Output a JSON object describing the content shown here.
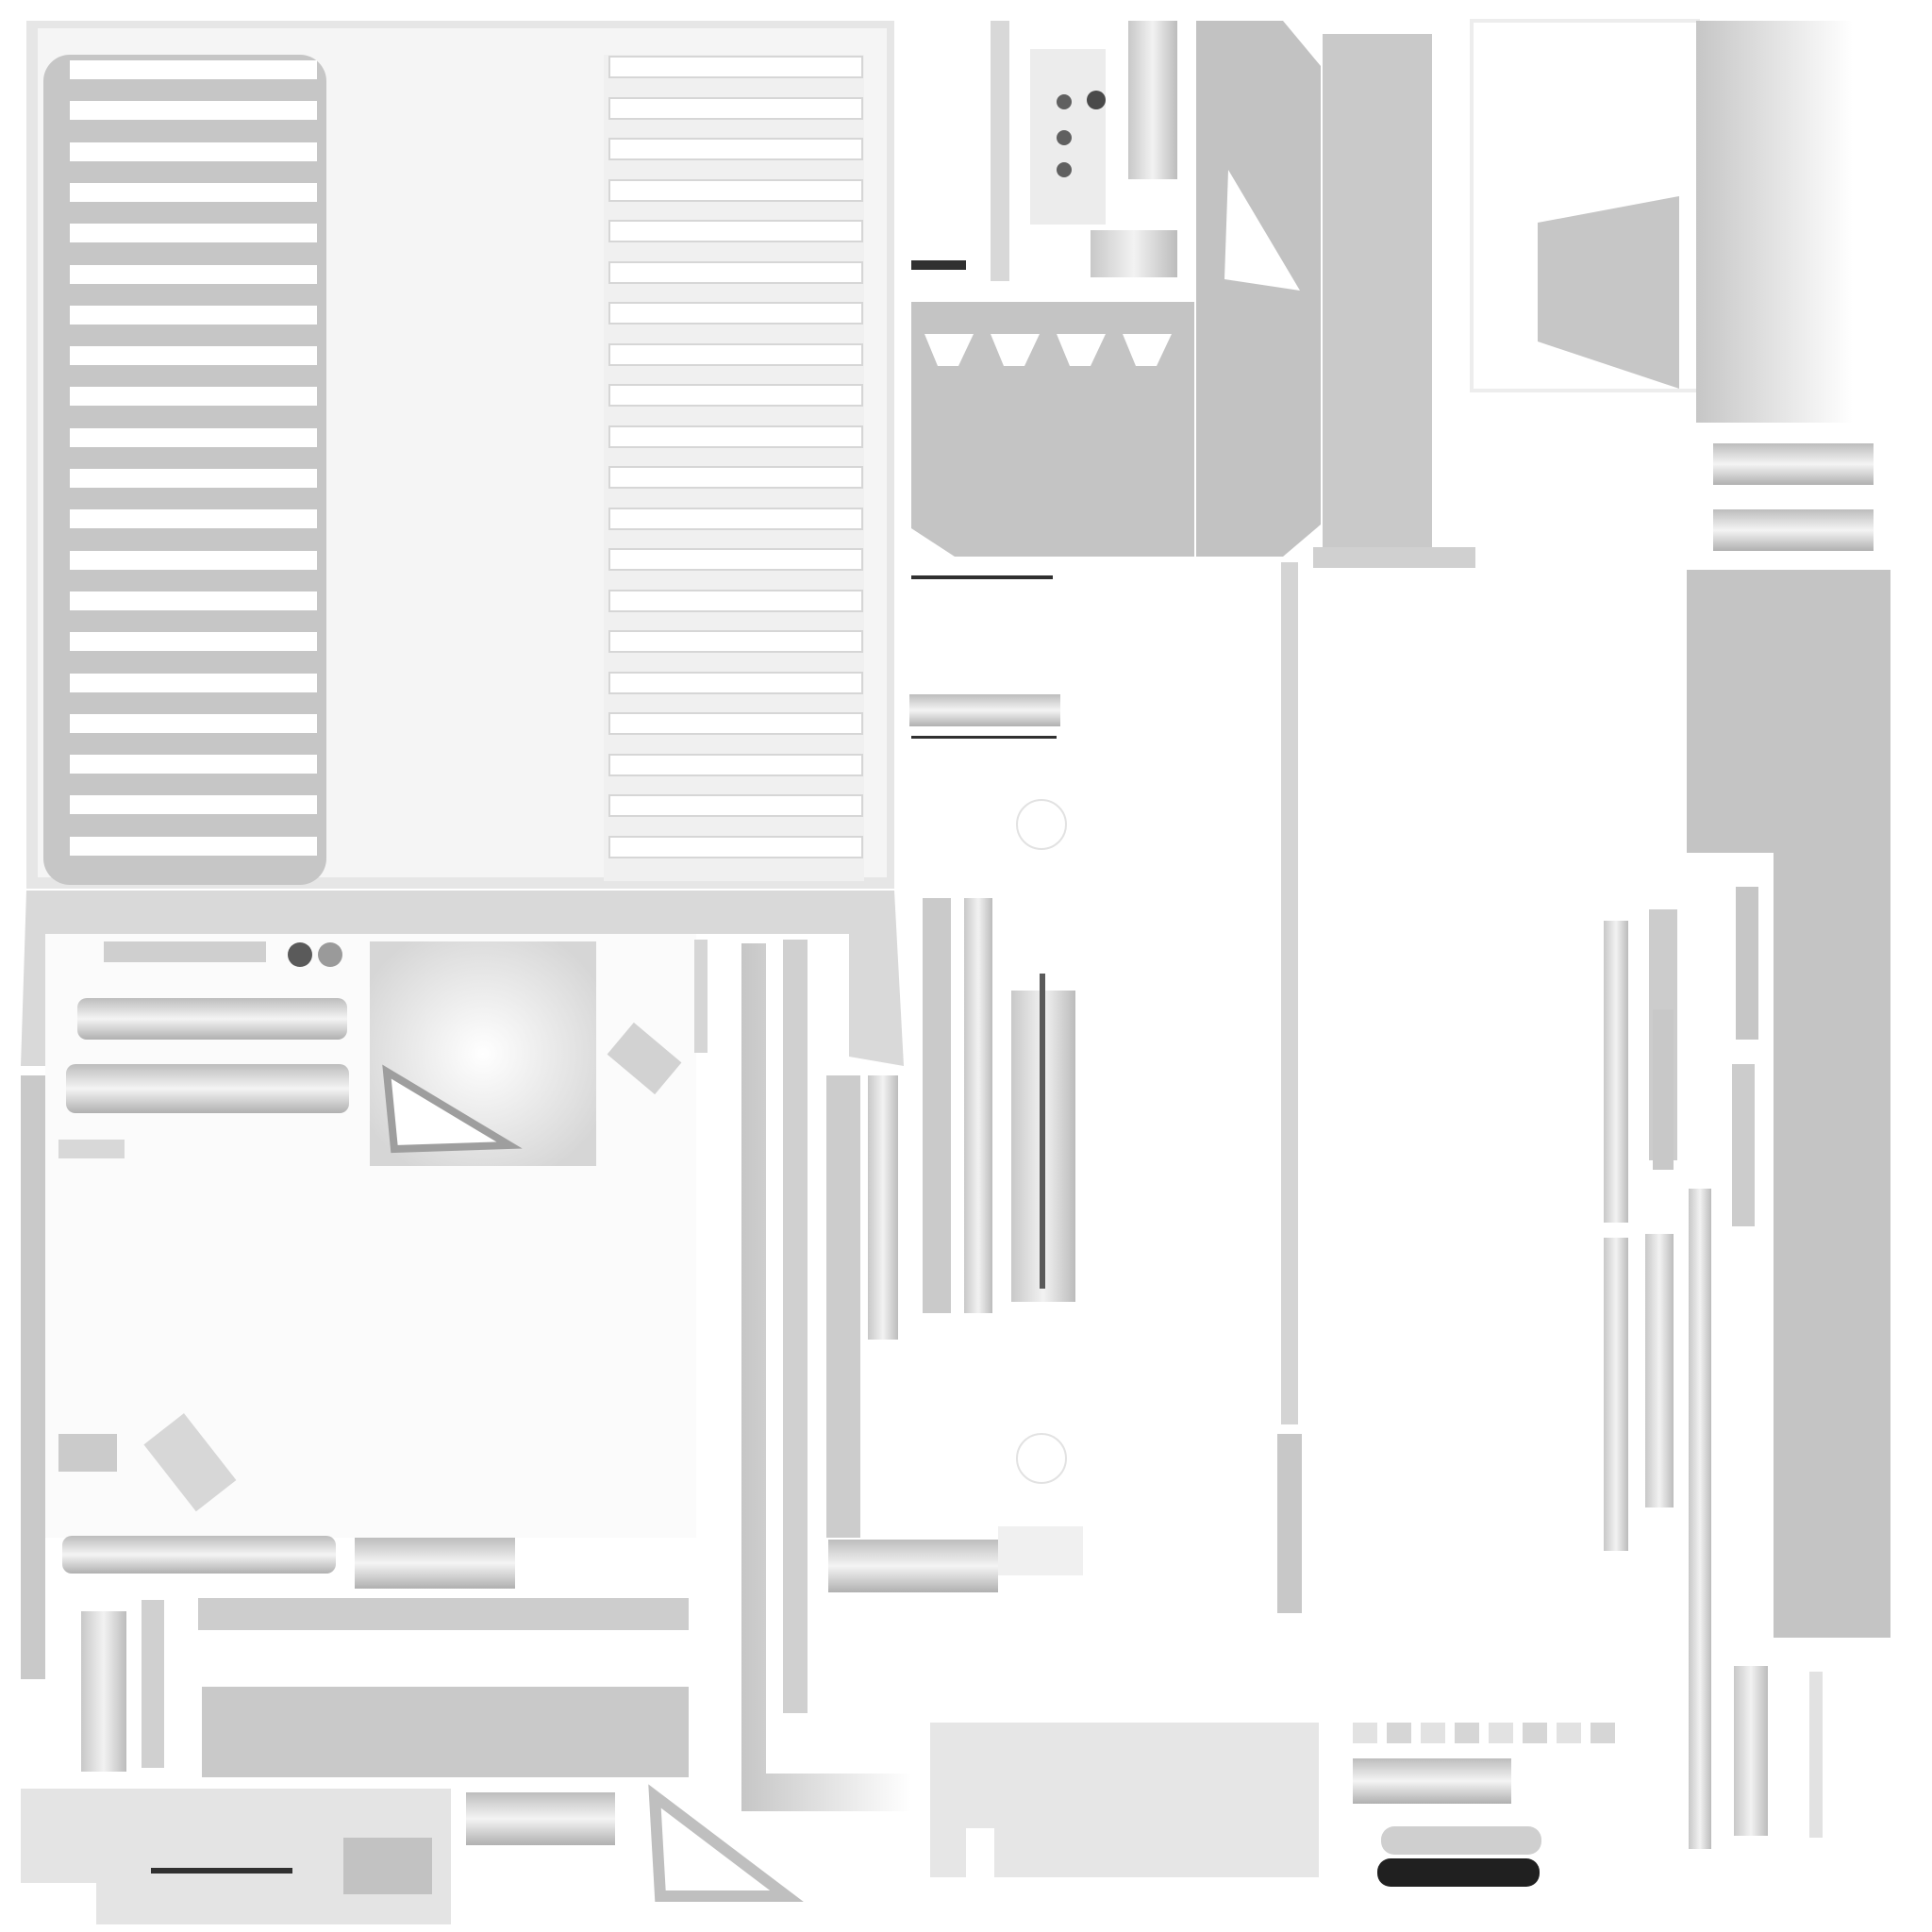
{
  "texture": {
    "kind": "ambient-occlusion bake atlas",
    "background_color": "#ffffff",
    "panel_color": "#c4c4c4",
    "light_panel_color": "#ececec",
    "shadow_color": "#8a8a8a",
    "dark_color": "#202020"
  },
  "islands": {
    "large_vented_panel": {
      "left_vent_slots": 20,
      "right_vent_slots": 20
    },
    "jack_plate": {
      "screw_holes": 3
    },
    "connector_plate": {
      "triangle_cutouts": 4
    },
    "small_clips": {
      "count": 8
    }
  }
}
